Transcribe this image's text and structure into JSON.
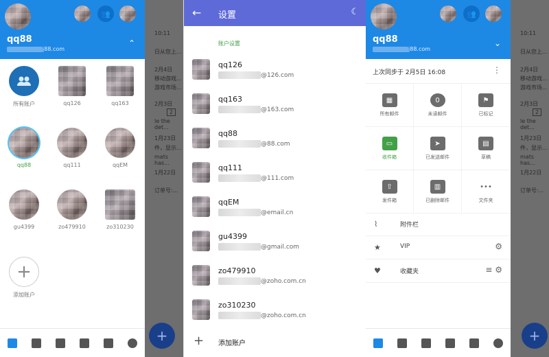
{
  "left": {
    "header": {
      "name": "qq88",
      "email_suffix": "j88.com",
      "chevron": "⌃"
    },
    "accounts": [
      {
        "label": "所有账户",
        "kind": "all"
      },
      {
        "label": "qq126"
      },
      {
        "label": "qq163"
      },
      {
        "label": "qq88",
        "selected": true
      },
      {
        "label": "qq111"
      },
      {
        "label": "qqEM"
      },
      {
        "label": "gu4399"
      },
      {
        "label": "zo479910"
      },
      {
        "label": "zo310230"
      },
      {
        "label": "添加账户",
        "kind": "add"
      }
    ],
    "shade_list": [
      {
        "text": "10:11"
      },
      {
        "text": "日从您上..."
      },
      {
        "text": "2月4日"
      },
      {
        "text": "移动游戏..."
      },
      {
        "text": "游戏市场..."
      },
      {
        "text": "2月3日"
      },
      {
        "text": "2"
      },
      {
        "text": "le the det..."
      },
      {
        "text": "1月23日"
      },
      {
        "text": "件，显示..."
      },
      {
        "text": "mats has..."
      },
      {
        "text": "1月22日"
      },
      {
        "text": "订单号:..."
      }
    ],
    "fab": "+"
  },
  "mid": {
    "title": "设置",
    "section": "账户设置",
    "accounts": [
      {
        "name": "qq126",
        "domain": "@126.com"
      },
      {
        "name": "qq163",
        "domain": "@163.com"
      },
      {
        "name": "qq88",
        "domain": "@88.com"
      },
      {
        "name": "qq111",
        "domain": "@111.com"
      },
      {
        "name": "qqEM",
        "domain": "@email.cn"
      },
      {
        "name": "gu4399",
        "domain": "@gmail.com"
      },
      {
        "name": "zo479910",
        "domain": "@zoho.com.cn"
      },
      {
        "name": "zo310230",
        "domain": "@zoho.com.cn"
      }
    ],
    "add_account": "添加账户"
  },
  "right": {
    "header": {
      "name": "qq88",
      "email_suffix": "j88.com",
      "chevron": "⌄"
    },
    "sync_text": "上次同步于 2月5日 16:08",
    "grid": [
      {
        "label": "所有邮件",
        "glyph": "▦"
      },
      {
        "label": "未读邮件",
        "glyph": "0"
      },
      {
        "label": "已标记",
        "glyph": "⚑"
      },
      {
        "label": "收件箱",
        "glyph": "▭",
        "active": true
      },
      {
        "label": "已发送邮件",
        "glyph": "➤"
      },
      {
        "label": "草稿",
        "glyph": "▤"
      },
      {
        "label": "发件箱",
        "glyph": "⇧"
      },
      {
        "label": "已删除邮件",
        "glyph": "▥"
      },
      {
        "label": "文件夹",
        "glyph": "•••"
      }
    ],
    "folders": [
      {
        "icon": "⌇",
        "label": "附件栏",
        "right": ""
      },
      {
        "icon": "★",
        "label": "VIP",
        "right": "⚙"
      },
      {
        "icon": "♥",
        "label": "收藏夹",
        "right": "≡  ⚙"
      }
    ],
    "shade_list": [
      {
        "text": "10:11"
      },
      {
        "text": "日从您上..."
      },
      {
        "text": "2月4日"
      },
      {
        "text": "移动游戏..."
      },
      {
        "text": "游戏市场..."
      },
      {
        "text": "2月3日"
      },
      {
        "text": "2"
      },
      {
        "text": "le the det..."
      },
      {
        "text": "1月23日"
      },
      {
        "text": "件，显示..."
      },
      {
        "text": "mats has..."
      },
      {
        "text": "1月22日"
      },
      {
        "text": "订单号:..."
      }
    ],
    "fab": "+"
  },
  "colors": {
    "primary": "#1e88e5",
    "settings_bar": "#5e6ad8",
    "accent_green": "#43a047"
  }
}
